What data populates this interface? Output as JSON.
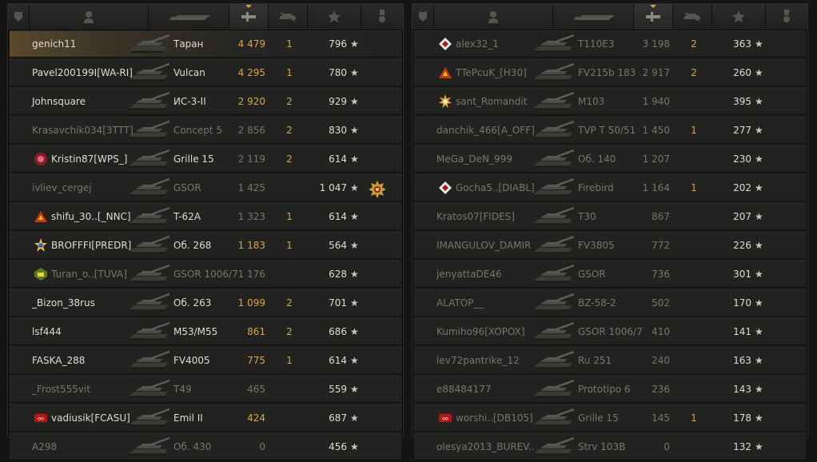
{
  "header_icons": [
    "shield-icon",
    "player-icon",
    "tank-icon",
    "damage-icon",
    "kills-icon",
    "xp-star-icon",
    "medal-icon"
  ],
  "colors": {
    "gold": "#d4a74a",
    "dim": "#77756e",
    "bright": "#dedcd3"
  },
  "left_team": [
    {
      "player": "genich11",
      "vehicle": "Таран",
      "damage": "4 479",
      "kills": "1",
      "xp": "796",
      "badge": "",
      "top": true,
      "style": "white",
      "dmgstyle": "gold"
    },
    {
      "player": "Pavel200199I[WA-RI]",
      "vehicle": "Vulcan",
      "damage": "4 295",
      "kills": "1",
      "xp": "780",
      "badge": "",
      "style": "white",
      "dmgstyle": "gold"
    },
    {
      "player": "Johnsquare",
      "vehicle": "ИС-3-II",
      "damage": "2 920",
      "kills": "2",
      "xp": "929",
      "badge": "",
      "style": "white",
      "dmgstyle": "gold"
    },
    {
      "player": "Krasavchik034[3TTT]",
      "vehicle": "Concept 5",
      "damage": "2 856",
      "kills": "2",
      "xp": "830",
      "badge": "",
      "style": "dim",
      "dmgstyle": "dim"
    },
    {
      "player": "Kristin87[WPS_]",
      "vehicle": "Grille 15",
      "damage": "2 119",
      "kills": "2",
      "xp": "614",
      "badge": "clan-red",
      "style": "white",
      "dmgstyle": "dim"
    },
    {
      "player": "ivliev_cergej",
      "vehicle": "GSOR",
      "damage": "1 425",
      "kills": "",
      "xp": "1 047",
      "badge": "",
      "medal": true,
      "style": "dim",
      "dmgstyle": "dim"
    },
    {
      "player": "shifu_30..[_NNC]",
      "vehicle": "T-62A",
      "damage": "1 323",
      "kills": "1",
      "xp": "614",
      "badge": "clan-triangle",
      "style": "white",
      "dmgstyle": "dim"
    },
    {
      "player": "BROFFFI[PREDR]",
      "vehicle": "Об. 268",
      "damage": "1 183",
      "kills": "1",
      "xp": "564",
      "badge": "clan-star",
      "style": "white",
      "dmgstyle": "gold"
    },
    {
      "player": "Turan_o..[TUVA]",
      "vehicle": "GSOR 1006/7",
      "damage": "1 176",
      "kills": "",
      "xp": "628",
      "badge": "clan-green",
      "style": "dim",
      "dmgstyle": "dim"
    },
    {
      "player": "_Bizon_38rus",
      "vehicle": "Об. 263",
      "damage": "1 099",
      "kills": "2",
      "xp": "701",
      "badge": "",
      "style": "white",
      "dmgstyle": "gold"
    },
    {
      "player": "lsf444",
      "vehicle": "M53/M55",
      "damage": "861",
      "kills": "2",
      "xp": "686",
      "badge": "",
      "style": "white",
      "dmgstyle": "gold"
    },
    {
      "player": "FASKA_288",
      "vehicle": "FV4005",
      "damage": "775",
      "kills": "1",
      "xp": "614",
      "badge": "",
      "style": "white",
      "dmgstyle": "gold"
    },
    {
      "player": "_Frost555vit",
      "vehicle": "T49",
      "damage": "465",
      "kills": "",
      "xp": "559",
      "badge": "",
      "style": "dim",
      "dmgstyle": "dim"
    },
    {
      "player": "vadiusik[FCASU]",
      "vehicle": "Emil II",
      "damage": "424",
      "kills": "",
      "xp": "687",
      "badge": "clan-red2",
      "style": "white",
      "dmgstyle": "gold"
    },
    {
      "player": "A298",
      "vehicle": "Об. 430",
      "damage": "0",
      "kills": "",
      "xp": "456",
      "badge": "",
      "style": "dim",
      "dmgstyle": "dim"
    }
  ],
  "right_team": [
    {
      "player": "alex32_1",
      "vehicle": "T110E3",
      "damage": "3 198",
      "kills": "2",
      "xp": "363",
      "badge": "clan-diamond",
      "style": "dim",
      "dmgstyle": "dim"
    },
    {
      "player": "TTePcuK_[H30]",
      "vehicle": "FV215b 183",
      "damage": "2 917",
      "kills": "2",
      "xp": "260",
      "badge": "clan-triangle",
      "style": "dim",
      "dmgstyle": "dim"
    },
    {
      "player": "sant_Romandit",
      "vehicle": "M103",
      "damage": "1 940",
      "kills": "",
      "xp": "395",
      "badge": "clan-sun",
      "style": "dim",
      "dmgstyle": "dim"
    },
    {
      "player": "danchik_466[A_OFF]",
      "vehicle": "TVP T 50/51",
      "damage": "1 450",
      "kills": "1",
      "xp": "277",
      "badge": "",
      "style": "dim",
      "dmgstyle": "dim"
    },
    {
      "player": "MeGa_DeN_999",
      "vehicle": "Об. 140",
      "damage": "1 207",
      "kills": "",
      "xp": "230",
      "badge": "",
      "style": "dim",
      "dmgstyle": "dim"
    },
    {
      "player": "Gocha5..[DIABL]",
      "vehicle": "Firebird",
      "damage": "1 164",
      "kills": "1",
      "xp": "202",
      "badge": "clan-diamond",
      "style": "dim",
      "dmgstyle": "dim"
    },
    {
      "player": "Kratos07[FIDES]",
      "vehicle": "T30",
      "damage": "867",
      "kills": "",
      "xp": "207",
      "badge": "",
      "style": "dim",
      "dmgstyle": "dim"
    },
    {
      "player": "IMANGULOV_DAMIR",
      "vehicle": "FV3805",
      "damage": "772",
      "kills": "",
      "xp": "226",
      "badge": "",
      "style": "dim",
      "dmgstyle": "dim"
    },
    {
      "player": "jenyattaDE46",
      "vehicle": "GSOR",
      "damage": "736",
      "kills": "",
      "xp": "301",
      "badge": "",
      "style": "dim",
      "dmgstyle": "dim"
    },
    {
      "player": "ALATOP__",
      "vehicle": "BZ-58-2",
      "damage": "502",
      "kills": "",
      "xp": "170",
      "badge": "",
      "style": "dim",
      "dmgstyle": "dim"
    },
    {
      "player": "Kumiho96[XOPOX]",
      "vehicle": "GSOR 1006/7",
      "damage": "410",
      "kills": "",
      "xp": "141",
      "badge": "",
      "style": "dim",
      "dmgstyle": "dim"
    },
    {
      "player": "lev72pantrike_12",
      "vehicle": "Ru 251",
      "damage": "240",
      "kills": "",
      "xp": "163",
      "badge": "",
      "style": "dim",
      "dmgstyle": "dim"
    },
    {
      "player": "e88484177",
      "vehicle": "Prototipo 6",
      "damage": "236",
      "kills": "",
      "xp": "143",
      "badge": "",
      "style": "dim",
      "dmgstyle": "dim"
    },
    {
      "player": "worshi..[DB105]",
      "vehicle": "Grille 15",
      "damage": "145",
      "kills": "1",
      "xp": "178",
      "badge": "clan-red2",
      "style": "dim",
      "dmgstyle": "dim"
    },
    {
      "player": "olesya2013_BUREV..",
      "vehicle": "Strv 103B",
      "damage": "0",
      "kills": "",
      "xp": "132",
      "badge": "",
      "style": "dim",
      "dmgstyle": "dim"
    }
  ]
}
